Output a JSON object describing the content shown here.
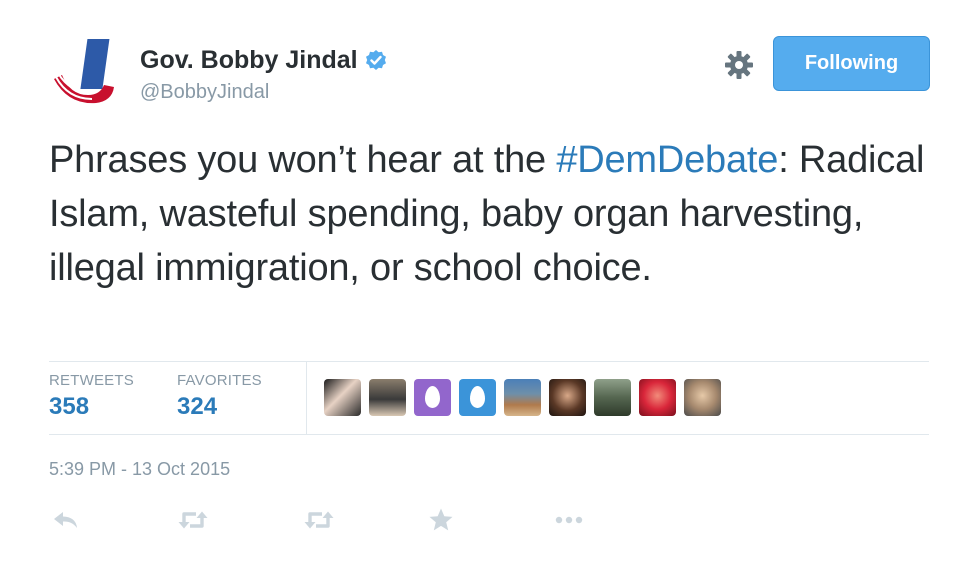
{
  "user": {
    "name": "Gov. Bobby Jindal",
    "handle": "@BobbyJindal",
    "verified_icon": "verified-badge-icon",
    "avatar_icon": "j-logo-icon"
  },
  "header": {
    "settings_icon": "gear-icon",
    "follow_button_label": "Following"
  },
  "tweet": {
    "text_before": "Phrases you won’t hear at the ",
    "hashtag": "#DemDebate",
    "text_after": ": Radical Islam, wasteful spending, baby organ harvesting, illegal immigration, or school choice."
  },
  "stats": {
    "retweets_label": "RETWEETS",
    "retweets_count": "358",
    "favorites_label": "FAVORITES",
    "favorites_count": "324"
  },
  "favoriters": [
    "user-avatar-1",
    "user-avatar-2",
    "egg-avatar-purple",
    "egg-avatar-blue",
    "user-avatar-5",
    "user-avatar-6",
    "user-avatar-7",
    "user-avatar-8",
    "user-avatar-9"
  ],
  "timestamp": "5:39 PM - 13 Oct 2015",
  "actions": [
    "reply-icon",
    "retweet-icon",
    "retweet-icon",
    "favorite-star-icon",
    "more-dots-icon"
  ],
  "colors": {
    "accent": "#55acee",
    "link": "#2b7bb9",
    "text": "#292f33",
    "muted": "#8899a6",
    "border": "#e1e8ed"
  }
}
